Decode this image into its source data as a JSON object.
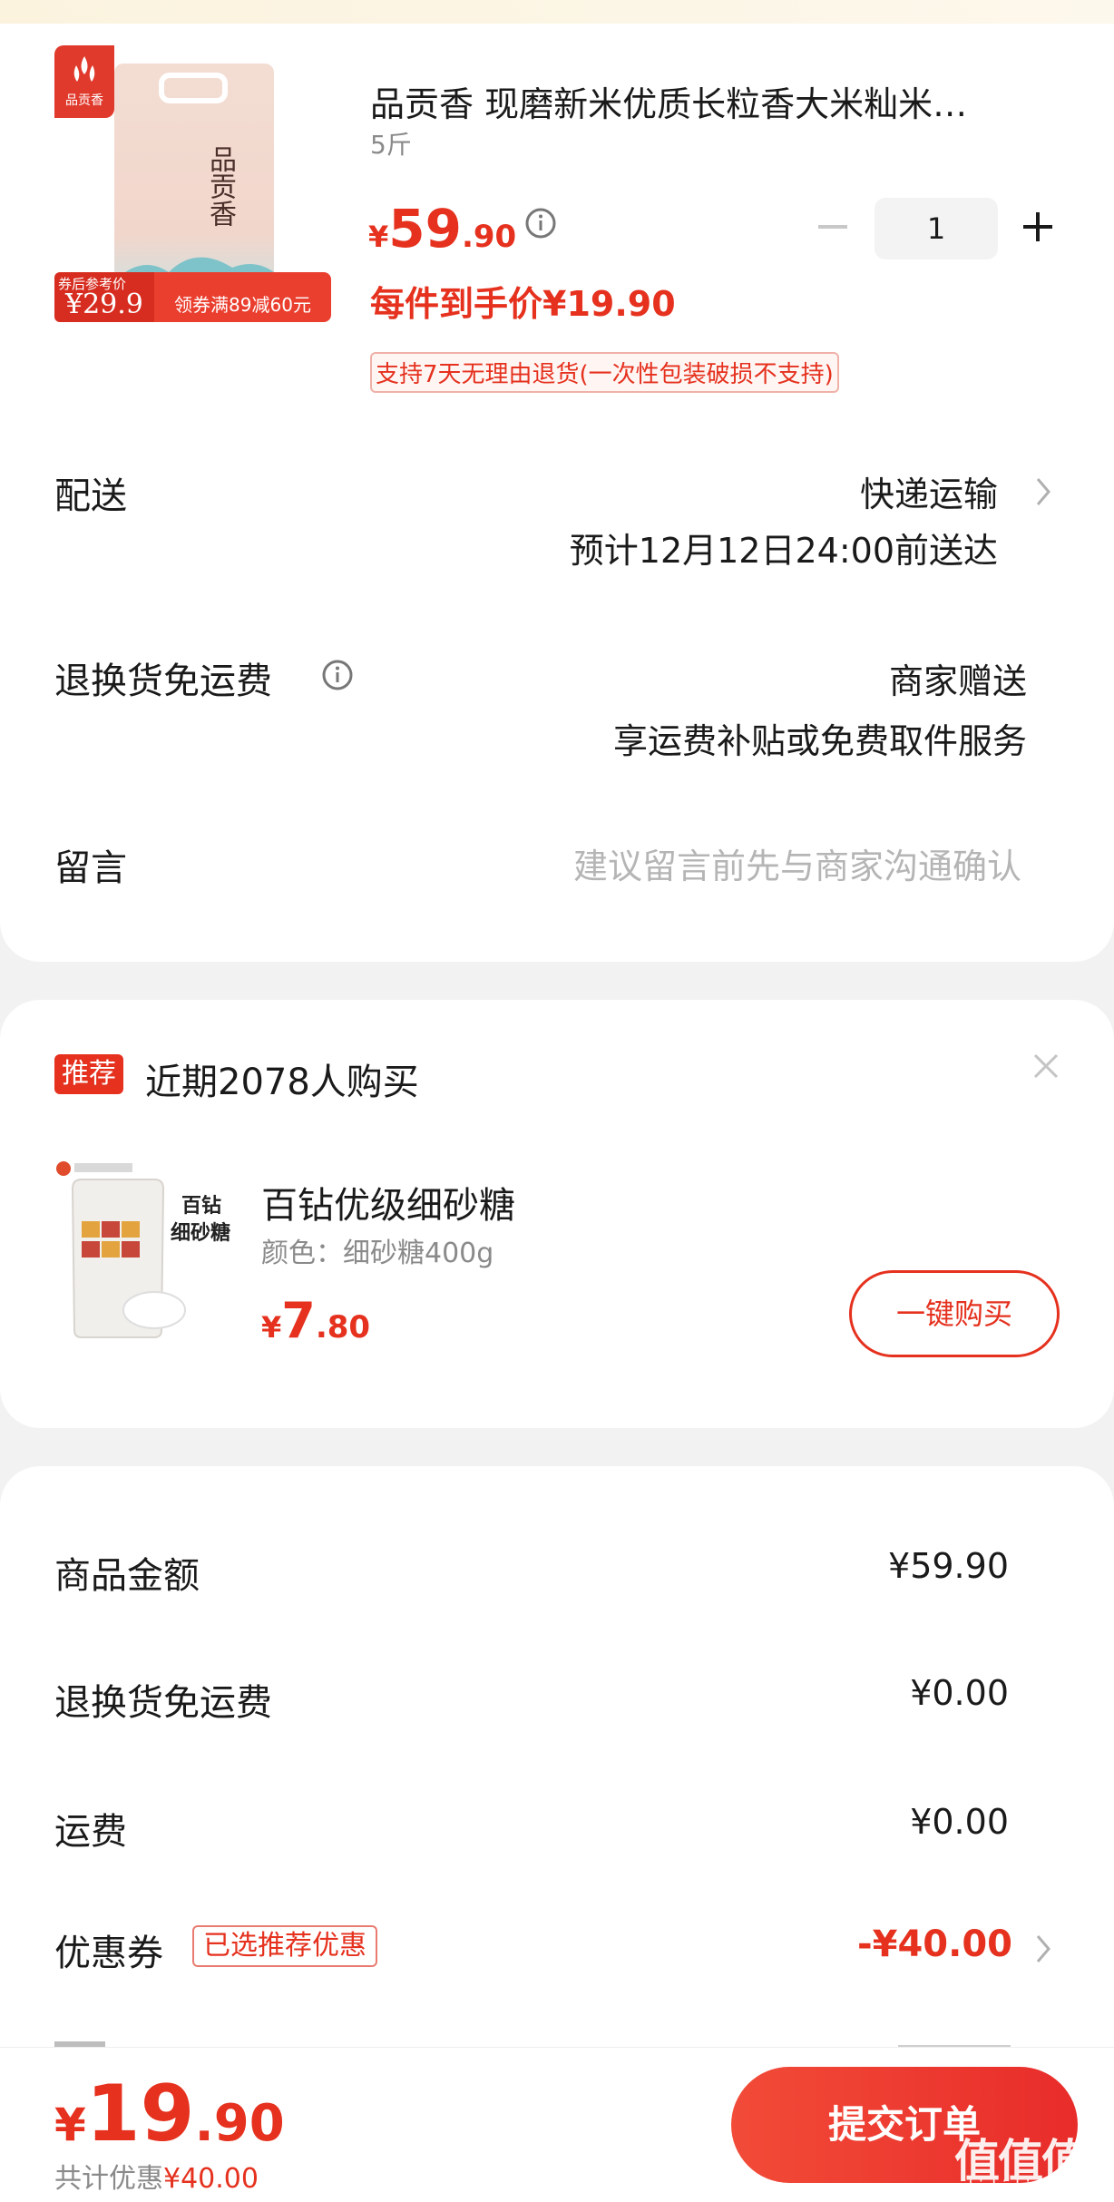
{
  "product": {
    "title": "品贡香 现磨新米优质长粒香大米籼米…",
    "spec": "5斤",
    "brand_logo_text": "品贡香",
    "bag_text": "品贡香",
    "image_promo_tag": "券后参考价",
    "image_promo_value": "¥29.9",
    "image_promo_coupon": "领券满89减60元",
    "price_symbol": "¥",
    "price_int": "59",
    "price_dec": ".90",
    "quantity": "1",
    "deal_price": "每件到手价¥19.90",
    "return_policy": "支持7天无理由退货(一次性包装破损不支持)"
  },
  "delivery": {
    "label": "配送",
    "method": "快递运输",
    "eta": "预计12月12日24:00前送达"
  },
  "return_shipping": {
    "label": "退换货免运费",
    "value": "商家赠送",
    "desc": "享运费补贴或免费取件服务"
  },
  "message": {
    "label": "留言",
    "placeholder": "建议留言前先与商家沟通确认"
  },
  "recommend": {
    "tag": "推荐",
    "title": "近期2078人购买",
    "item": {
      "name": "百钻优级细砂糖",
      "spec": "颜色：细砂糖400g",
      "price_symbol": "¥",
      "price_int": "7",
      "price_dec": ".80",
      "buy_label": "一键购买"
    }
  },
  "summary": {
    "goods_label": "商品金额",
    "goods_value": "¥59.90",
    "return_label": "退换货免运费",
    "return_value": "¥0.00",
    "shipping_label": "运费",
    "shipping_value": "¥0.00",
    "coupon_label": "优惠券",
    "coupon_badge": "已选推荐优惠",
    "coupon_value": "-¥40.00"
  },
  "bottom": {
    "price_symbol": "¥",
    "price_int": "19",
    "price_dec": ".90",
    "saved_label": "共计优惠",
    "saved_value": "¥40.00",
    "submit_label": "提交订单",
    "watermark": "值值值",
    "watermark_url": "zhizhizhi.com"
  },
  "colors": {
    "accent": "#e5311e",
    "background": "#f2f2f2",
    "muted": "#8a8a8a"
  }
}
